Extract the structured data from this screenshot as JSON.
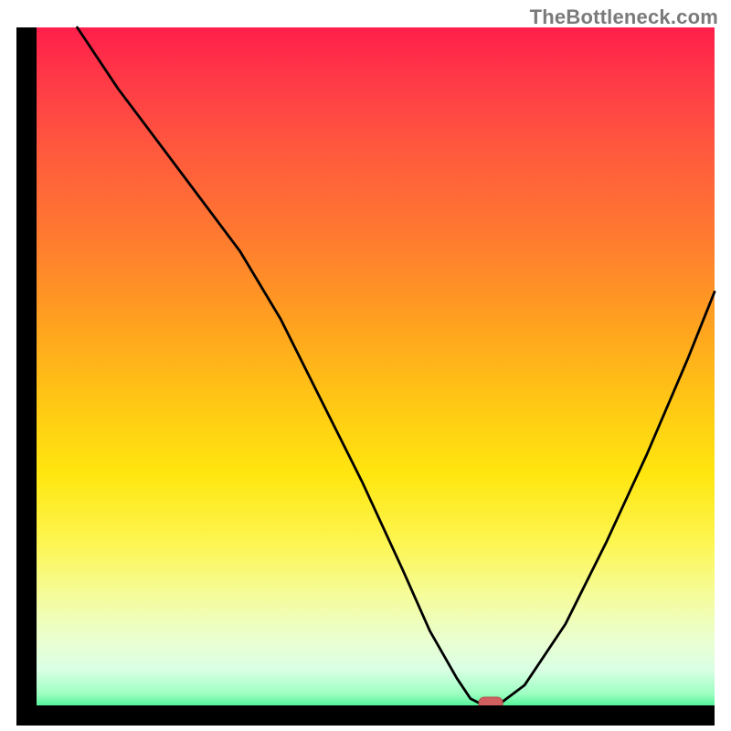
{
  "watermark": "TheBottleneck.com",
  "chart_data": {
    "type": "line",
    "title": "",
    "xlabel": "",
    "ylabel": "",
    "xlim": [
      0,
      100
    ],
    "ylim": [
      0,
      100
    ],
    "grid": false,
    "legend": false,
    "x": [
      6,
      12,
      18,
      24,
      30,
      36,
      42,
      48,
      54,
      58,
      62,
      64,
      66,
      68,
      72,
      78,
      84,
      90,
      96,
      100
    ],
    "values": [
      100,
      91,
      83,
      75,
      67,
      57,
      45,
      33,
      20,
      11,
      4,
      1,
      0,
      0,
      3,
      12,
      24,
      37,
      51,
      61
    ],
    "minimum_marker": {
      "x": 67,
      "y": 0
    },
    "gradient_colors": {
      "top": "#ff1f4b",
      "mid": "#ffe60f",
      "bottom": "#17d877"
    }
  }
}
